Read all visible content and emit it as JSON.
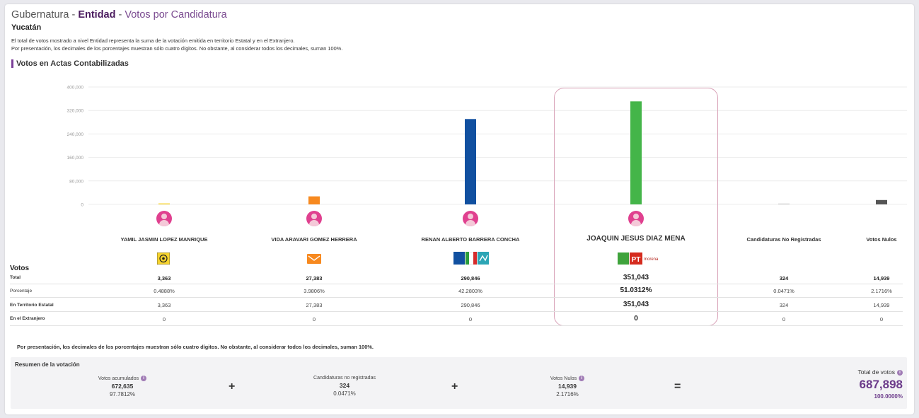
{
  "header": {
    "title_part1": "Gubernatura",
    "separator": " - ",
    "title_part2": "Entidad",
    "title_part3": "Votos por Candidatura",
    "state": "Yucatán",
    "note1": "El total de votos mostrado a nivel Entidad representa la suma de la votación emitida en territorio Estatal y en el Extranjero.",
    "note2": "Por presentación, los decimales de los porcentajes muestran sólo cuatro dígitos. No obstante, al considerar todos los decimales, suman 100%."
  },
  "section_title": "Votos en Actas Contabilizadas",
  "chart_data": {
    "type": "bar",
    "categories": [
      "YAMIL JASMIN LOPEZ MANRIQUE",
      "VIDA ARAVARI GOMEZ HERRERA",
      "RENAN ALBERTO BARRERA CONCHA",
      "JOAQUIN JESUS DIAZ MENA",
      "Candidaturas No Registradas",
      "Votos Nulos"
    ],
    "values": [
      3363,
      27383,
      290846,
      351043,
      324,
      14939
    ],
    "colors": [
      "#f6d32d",
      "#f7891f",
      "#1150a0",
      "#44b549",
      "#cccccc",
      "#555555"
    ],
    "y_ticks": [
      "400,000",
      "320,000",
      "240,000",
      "160,000",
      "80,000",
      "0"
    ],
    "ylim": [
      0,
      400000
    ],
    "grid": true
  },
  "table": {
    "votos_label": "Votos",
    "row_labels": [
      "Total",
      "Porcentaje",
      "En Territorio Estatal",
      "En el Extranjero"
    ],
    "columns": [
      {
        "total": "3,363",
        "pct": "0.4888%",
        "estatal": "3,363",
        "extranjero": "0"
      },
      {
        "total": "27,383",
        "pct": "3.9806%",
        "estatal": "27,383",
        "extranjero": "0"
      },
      {
        "total": "290,846",
        "pct": "42.2803%",
        "estatal": "290,846",
        "extranjero": "0"
      },
      {
        "total": "351,043",
        "pct": "51.0312%",
        "estatal": "351,043",
        "extranjero": "0"
      },
      {
        "total": "324",
        "pct": "0.0471%",
        "estatal": "324",
        "extranjero": "0"
      },
      {
        "total": "14,939",
        "pct": "2.1716%",
        "estatal": "14,939",
        "extranjero": "0"
      }
    ]
  },
  "logos": {
    "pt_text": "PT",
    "morena_text": "morena"
  },
  "footnote": "Por presentación, los decimales de los porcentajes muestran sólo cuatro dígitos. No obstante, al considerar todos los decimales, suman 100%.",
  "summary": {
    "title": "Resumen de la votación",
    "acumulados_label": "Votos acumulados",
    "acumulados_value": "672,635",
    "acumulados_pct": "97.7812%",
    "no_reg_label": "Candidaturas no registradas",
    "no_reg_value": "324",
    "no_reg_pct": "0.0471%",
    "nulos_label": "Votos Nulos",
    "nulos_value": "14,939",
    "nulos_pct": "2.1716%",
    "total_label": "Total de votos",
    "total_value": "687,898",
    "total_pct": "100.0000%",
    "plus": "+",
    "equals": "="
  }
}
